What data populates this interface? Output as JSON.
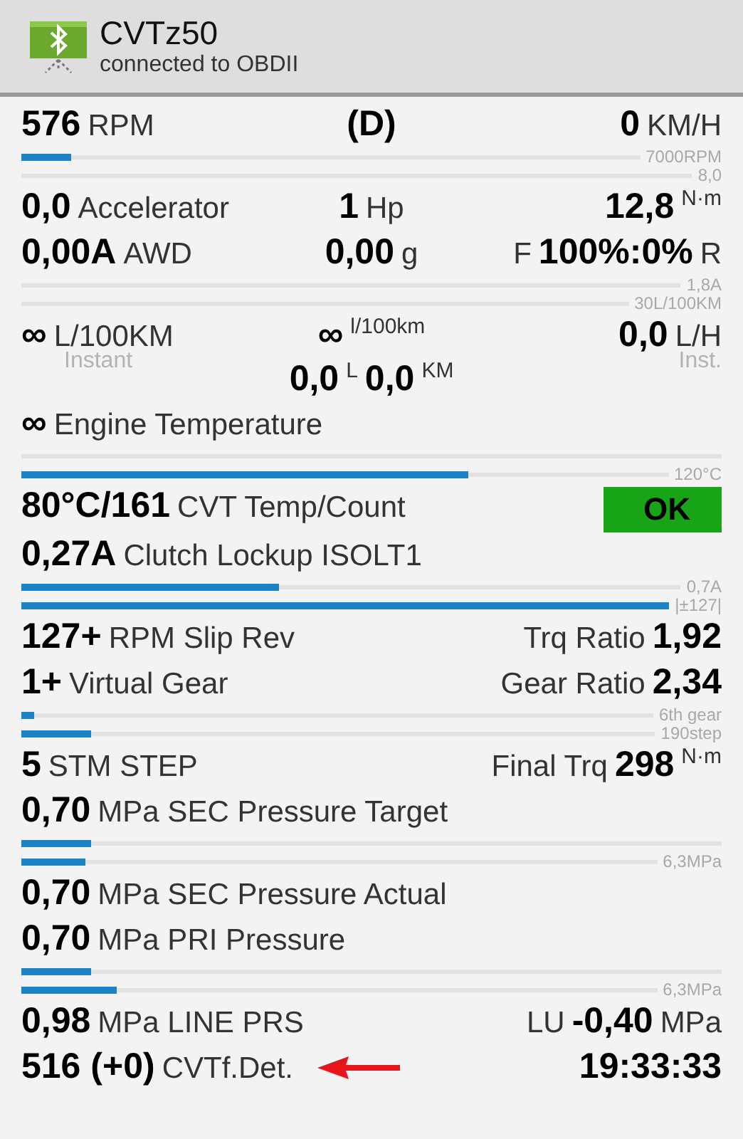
{
  "header": {
    "title": "CVTz50",
    "subtitle": "connected to OBDII"
  },
  "rows": [
    {
      "kind": "readout",
      "left": [
        [
          {
            "kind": "value",
            "text": "576"
          },
          {
            "kind": "unit",
            "text": "RPM"
          }
        ]
      ],
      "center": [
        [
          {
            "kind": "value",
            "text": "(D)"
          }
        ]
      ],
      "right": [
        [
          {
            "kind": "value",
            "text": "0"
          },
          {
            "kind": "unit",
            "text": "KM/H"
          }
        ]
      ]
    },
    {
      "kind": "bar",
      "level": 0.08,
      "max": "7000RPM"
    },
    {
      "kind": "bar",
      "max": "8,0"
    },
    {
      "kind": "readout",
      "left": [
        [
          {
            "kind": "value",
            "text": "0,0"
          },
          {
            "kind": "unit",
            "text": "Accelerator"
          }
        ]
      ],
      "center": [
        [
          {
            "kind": "value",
            "text": "1"
          },
          {
            "kind": "unit",
            "text": "Hp"
          }
        ]
      ],
      "right": [
        [
          {
            "kind": "value",
            "text": "12,8"
          },
          {
            "kind": "sup",
            "text": "N·m"
          }
        ]
      ]
    },
    {
      "kind": "readout",
      "left": [
        [
          {
            "kind": "value",
            "text": "0,00A"
          },
          {
            "kind": "unit",
            "text": "AWD"
          }
        ]
      ],
      "center": [
        [
          {
            "kind": "value",
            "text": "0,00"
          },
          {
            "kind": "unit",
            "text": "g"
          }
        ]
      ],
      "right": [
        [
          {
            "kind": "unit",
            "text": "F"
          },
          {
            "kind": "value",
            "text": "100%:0%"
          },
          {
            "kind": "unit",
            "text": "R"
          }
        ]
      ]
    },
    {
      "kind": "bar",
      "max": "1,8A"
    },
    {
      "kind": "bar",
      "max": "30L/100KM"
    },
    {
      "kind": "readout",
      "left": [
        [
          {
            "kind": "value",
            "text": "∞"
          },
          {
            "kind": "unit",
            "text": "L/100KM"
          }
        ],
        [
          {
            "kind": "hint",
            "text": "Instant"
          }
        ]
      ],
      "center": [
        [
          {
            "kind": "value",
            "text": "∞"
          },
          {
            "kind": "sup",
            "text": "l/100km"
          }
        ],
        [
          {
            "kind": "value",
            "text": "0,0"
          },
          {
            "kind": "sup",
            "text": "L"
          },
          {
            "kind": "value",
            "text": "0,0"
          },
          {
            "kind": "sup",
            "text": "KM"
          }
        ]
      ],
      "right": [
        [
          {
            "kind": "value",
            "text": "0,0"
          },
          {
            "kind": "unit",
            "text": "L/H"
          }
        ],
        [
          {
            "kind": "hint",
            "text": "Inst."
          }
        ]
      ]
    },
    {
      "kind": "readout",
      "left": [
        [
          {
            "kind": "value",
            "text": "∞"
          },
          {
            "kind": "unit",
            "text": "Engine Temperature"
          }
        ]
      ]
    },
    {
      "kind": "bar"
    },
    {
      "kind": "bar",
      "level": 0.69,
      "max": "120°C"
    },
    {
      "kind": "readout",
      "left": [
        [
          {
            "kind": "value",
            "text": "80°C/161"
          },
          {
            "kind": "unit",
            "text": "CVT Temp/Count"
          }
        ]
      ],
      "right": [
        [
          {
            "kind": "badge",
            "text": "OK"
          }
        ]
      ]
    },
    {
      "kind": "readout",
      "left": [
        [
          {
            "kind": "value",
            "text": "0,27A"
          },
          {
            "kind": "unit",
            "text": "Clutch Lockup ISOLT1"
          }
        ]
      ]
    },
    {
      "kind": "bar",
      "level": 0.39,
      "max": "0,7A"
    },
    {
      "kind": "bar",
      "level": 1,
      "max": "|±127|"
    },
    {
      "kind": "readout",
      "left": [
        [
          {
            "kind": "value",
            "text": "127+"
          },
          {
            "kind": "unit",
            "text": "RPM Slip Rev"
          }
        ]
      ],
      "right": [
        [
          {
            "kind": "unit",
            "text": "Trq Ratio"
          },
          {
            "kind": "value",
            "text": "1,92"
          }
        ]
      ]
    },
    {
      "kind": "readout",
      "left": [
        [
          {
            "kind": "value",
            "text": "1+"
          },
          {
            "kind": "unit",
            "text": "Virtual Gear"
          }
        ]
      ],
      "right": [
        [
          {
            "kind": "unit",
            "text": "Gear Ratio"
          },
          {
            "kind": "value",
            "text": "2,34"
          }
        ]
      ]
    },
    {
      "kind": "bar",
      "level": 0.02,
      "max": "6th gear"
    },
    {
      "kind": "bar",
      "level": 0.11,
      "max": "190step"
    },
    {
      "kind": "readout",
      "left": [
        [
          {
            "kind": "value",
            "text": "5"
          },
          {
            "kind": "unit",
            "text": "STM STEP"
          }
        ]
      ],
      "right": [
        [
          {
            "kind": "unit",
            "text": "Final Trq"
          },
          {
            "kind": "value",
            "text": "298"
          },
          {
            "kind": "sup",
            "text": "N·m"
          }
        ]
      ]
    },
    {
      "kind": "readout",
      "left": [
        [
          {
            "kind": "value",
            "text": "0,70"
          },
          {
            "kind": "unit",
            "text": "MPa SEC Pressure Target"
          }
        ]
      ]
    },
    {
      "kind": "bar",
      "level": 0.1
    },
    {
      "kind": "bar",
      "level": 0.1,
      "max": "6,3MPa"
    },
    {
      "kind": "readout",
      "left": [
        [
          {
            "kind": "value",
            "text": "0,70"
          },
          {
            "kind": "unit",
            "text": "MPa SEC Pressure Actual"
          }
        ]
      ]
    },
    {
      "kind": "readout",
      "left": [
        [
          {
            "kind": "value",
            "text": "0,70"
          },
          {
            "kind": "unit",
            "text": "MPa PRI Pressure"
          }
        ]
      ]
    },
    {
      "kind": "bar",
      "level": 0.1
    },
    {
      "kind": "bar",
      "level": 0.15,
      "max": "6,3MPa"
    },
    {
      "kind": "readout",
      "left": [
        [
          {
            "kind": "value",
            "text": "0,98"
          },
          {
            "kind": "unit",
            "text": "MPa LINE PRS"
          }
        ]
      ],
      "right": [
        [
          {
            "kind": "unit",
            "text": "LU"
          },
          {
            "kind": "value",
            "text": "-0,40"
          },
          {
            "kind": "unit",
            "text": "MPa"
          }
        ]
      ]
    },
    {
      "kind": "readout",
      "left": [
        [
          {
            "kind": "value",
            "text": "516 (+0)"
          },
          {
            "kind": "unit",
            "text": "CVTf.Det."
          },
          {
            "kind": "arrow"
          }
        ]
      ],
      "right": [
        [
          {
            "kind": "value",
            "text": "19:33:33"
          }
        ]
      ]
    }
  ]
}
